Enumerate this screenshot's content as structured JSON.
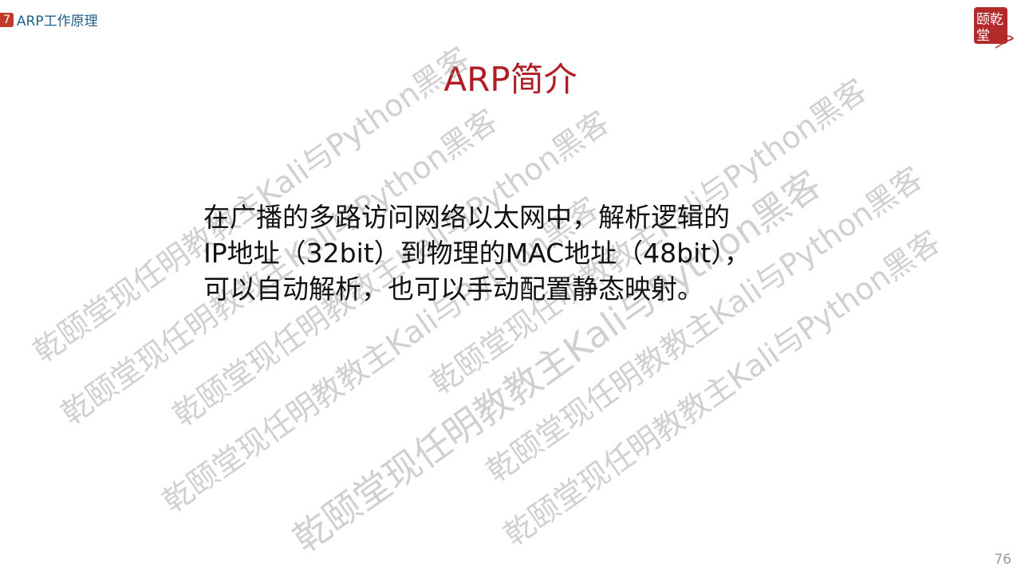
{
  "header": {
    "section_number": "7",
    "section_title": "ARP工作原理"
  },
  "logo": {
    "text": "乾颐堂",
    "color": "#b22a2a"
  },
  "slide": {
    "title": "ARP简介",
    "body_lines": [
      "在广播的多路访问网络以太网中，解析逻辑的",
      "IP地址（32bit）到物理的MAC地址（48bit），",
      "可以自动解析，也可以手动配置静态映射。"
    ]
  },
  "watermark": "乾颐堂现任明教教主Kali与Python黑客",
  "page_number": "76"
}
